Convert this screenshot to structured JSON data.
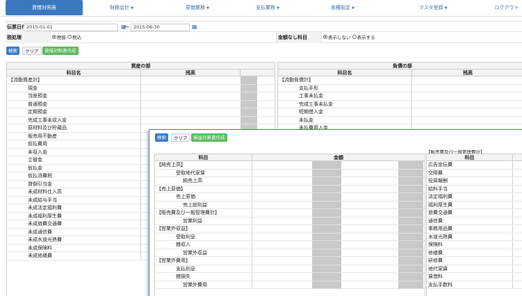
{
  "nav": {
    "items": [
      {
        "label": "貸借対照表",
        "active": true
      },
      {
        "label": "財務会計",
        "dropdown": true
      },
      {
        "label": "原価業務",
        "dropdown": true
      },
      {
        "label": "支払業務",
        "dropdown": true
      },
      {
        "label": "各種設定",
        "dropdown": true
      },
      {
        "label": "マスタ登録",
        "dropdown": true
      },
      {
        "label": "ログアウト"
      }
    ]
  },
  "filters": {
    "date_label": "伝票日付",
    "date_from": "2015-01-01",
    "date_to": "2015-06-30",
    "tilde": "〜",
    "tax_label": "税処理",
    "tax_options": [
      "税抜",
      "税込"
    ],
    "tax_selected": "税抜",
    "zero_label": "金額なし科目",
    "zero_options": [
      "表示しない",
      "表示する"
    ],
    "zero_selected": "表示しない"
  },
  "buttons": {
    "search": "検索",
    "clear": "クリア",
    "create_bs": "貸借対照表作成"
  },
  "assets": {
    "title": "資産の部",
    "col_name": "科目名",
    "col_amount": "残高",
    "rows": [
      "【流動資産計】",
      "現金",
      "当座預金",
      "普通預金",
      "定期預金",
      "完成工事未収入金",
      "原材料及び貯蔵品",
      "販売用不動産",
      "前払費用",
      "未収入金",
      "立替金",
      "仮払金",
      "仮払消費税",
      "貸倒引当金",
      "未成材料仕入高",
      "未成給与手当",
      "未成法定福利費",
      "未成福利厚生費",
      "未成旅費交通費",
      "未成通信費",
      "未成水道光熱費",
      "未成保険料",
      "未成修繕費"
    ]
  },
  "liabilities": {
    "title": "負債の部",
    "col_name": "科目名",
    "col_amount": "残高",
    "rows": [
      "【流動負債計】",
      "支払手形",
      "工事未払金",
      "完成工事未払金",
      "短期借入金",
      "未払金",
      "未払費用入金"
    ]
  },
  "overlay": {
    "buttons": {
      "search": "検索",
      "clear": "クリア",
      "create_pl": "損益計算書作成"
    },
    "col_name": "科目",
    "col_amount": "金額",
    "rows": [
      "【純売上高】",
      "受取地代家賃",
      "純売上高",
      "【売上原価】",
      "売上原価",
      "売上総利益",
      "【販売費及び一般管理費計】",
      "営業利益",
      "【営業外収益】",
      "受取利息",
      "雑収入",
      "営業外収益",
      "【営業外費用】",
      "支払利息",
      "雑損失",
      "営業外費用"
    ],
    "side_caption": "【販売費及び一般管理費計】",
    "side_col": "科目",
    "side_rows": [
      "広告宣伝費",
      "交際費",
      "役員報酬",
      "給料手当",
      "法定福利費",
      "福利厚生費",
      "旅費交通費",
      "通信費",
      "事務用品費",
      "水道光熱費",
      "保険料",
      "修繕費",
      "研修費",
      "地代家賃",
      "賃借料",
      "支払手数料"
    ]
  }
}
